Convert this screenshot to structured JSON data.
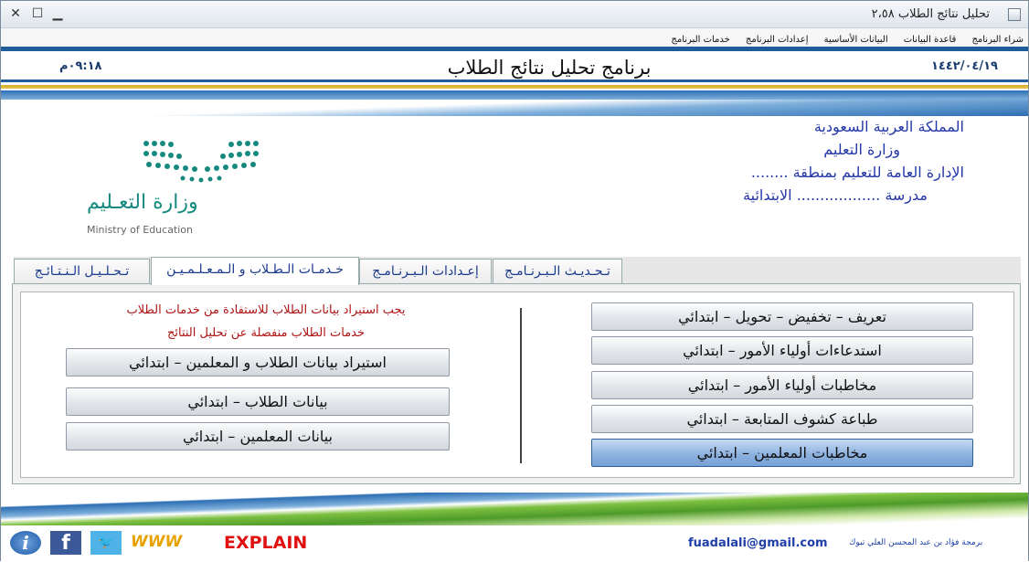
{
  "window": {
    "title": "تحليل نتائج الطلاب ٢،٥٨"
  },
  "menu": [
    "شراء البرنامج",
    "قاعدة البيانات",
    "البيانات الأساسية",
    "إعدادات البرنامج",
    "خدمات البرنامج"
  ],
  "header": {
    "date": "١٤٤٢/٠٤/١٩",
    "title": "برنامج تحليل نتائج الطلاب",
    "time": "٠٩:١٨م"
  },
  "ministry": {
    "line1": "المملكة العربية السعودية",
    "line2": "وزارة التعليم",
    "line3": "الإدارة العامة للتعليم بمنطقة ........",
    "line4": "مدرسة .................. الابتدائية"
  },
  "logo": {
    "arabic": "وزارة التعـليم",
    "english": "Ministry of Education",
    "color": "#168a7f"
  },
  "tabs": [
    "تـحـديـث الـبـرنـامـج",
    "إعـدادات الـبـرنـامـج",
    "خـدمـات الـطـلاب و الـمـعـلـمـيـن",
    "تـحـلـيـل الـنـتـائـج"
  ],
  "active_tab": 2,
  "left_buttons": [
    "تعريف – تخفيض – تحويل – ابتدائي",
    "استدعاءات أولياء الأمور – ابتدائي",
    "مخاطبات أولياء الأمور – ابتدائي",
    "طباعة كشوف المتابعة – ابتدائي",
    "مخاطبات المعلمين – ابتدائي"
  ],
  "right_notes": {
    "note1": "يجب استيراد بيانات الطلاب للاستفادة من خدمات الطلاب",
    "note2": "خدمات الطلاب منفصلة عن تحليل النتائج"
  },
  "right_buttons": [
    "استيراد بيانات الطلاب و المعلمين – ابتدائي",
    "بيانات الطلاب – ابتدائي",
    "بيانات المعلمين – ابتدائي"
  ],
  "footer": {
    "info_icon": "info-icon",
    "facebook_icon": "facebook-icon",
    "twitter_icon": "twitter-icon",
    "www_label": "WWW",
    "explain_label": "EXPLAIN",
    "email": "fuadalali@gmail.com",
    "credit": "برمجة فؤاد بن عبد المحسن العلي تبوك"
  },
  "colors": {
    "accent": "#1e5d9c",
    "note": "#b01414",
    "ministry_text": "#2437a8",
    "selected_button": "#8fb3e0"
  }
}
